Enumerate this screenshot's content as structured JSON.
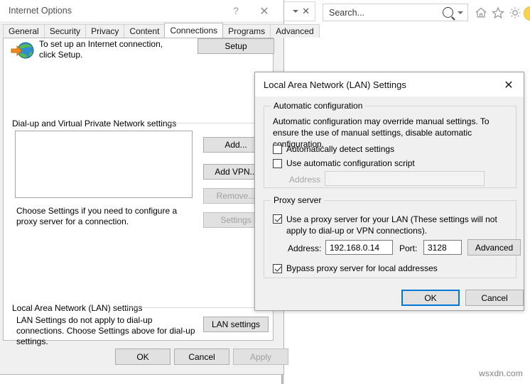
{
  "browser": {
    "tab_dropdown_icon": "chevron-down-icon",
    "tab_close_icon": "close-icon",
    "search": {
      "value": "Search...",
      "placeholder": "Search..."
    },
    "icons": [
      "home-icon",
      "favorites-star-icon",
      "gear-icon",
      "smiley-icon"
    ]
  },
  "watermark": "wsxdn.com",
  "internet_options": {
    "title": "Internet Options",
    "help_glyph": "?",
    "close_glyph": "✕",
    "tabs": [
      {
        "label": "General",
        "active": false
      },
      {
        "label": "Security",
        "active": false
      },
      {
        "label": "Privacy",
        "active": false
      },
      {
        "label": "Content",
        "active": false
      },
      {
        "label": "Connections",
        "active": true
      },
      {
        "label": "Programs",
        "active": false
      },
      {
        "label": "Advanced",
        "active": false
      }
    ],
    "setup": {
      "text": "To set up an Internet connection, click Setup.",
      "button": "Setup",
      "icon": "globe-with-arrow-icon"
    },
    "dialup": {
      "group_label": "Dial-up and Virtual Private Network settings",
      "list_items": [],
      "hint": "Choose Settings if you need to configure a proxy server for a connection.",
      "buttons": [
        {
          "label": "Add...",
          "enabled": true
        },
        {
          "label": "Add VPN...",
          "enabled": true
        },
        {
          "label": "Remove...",
          "enabled": false
        },
        {
          "label": "Settings",
          "enabled": false
        }
      ]
    },
    "lan": {
      "group_label": "Local Area Network (LAN) settings",
      "hint": "LAN Settings do not apply to dial-up connections. Choose Settings above for dial-up settings.",
      "button": "LAN settings"
    },
    "footer": {
      "ok": "OK",
      "cancel": "Cancel",
      "apply": "Apply",
      "apply_enabled": false
    }
  },
  "lan_dialog": {
    "title": "Local Area Network (LAN) Settings",
    "close_glyph": "✕",
    "automatic_configuration": {
      "legend": "Automatic configuration",
      "description": "Automatic configuration may override manual settings.  To ensure the use of manual settings, disable automatic configuration.",
      "auto_detect": {
        "label": "Automatically detect settings",
        "checked": false
      },
      "auto_script": {
        "label": "Use automatic configuration script",
        "checked": false
      },
      "address_label": "Address",
      "address_value": "",
      "address_enabled": false
    },
    "proxy_server": {
      "legend": "Proxy server",
      "use_proxy": {
        "label": "Use a proxy server for your LAN (These settings will not apply to dial-up or VPN connections).",
        "checked": true
      },
      "address_label": "Address:",
      "address_value": "192.168.0.14",
      "port_label": "Port:",
      "port_value": "3128",
      "advanced_button": "Advanced",
      "bypass": {
        "label": "Bypass proxy server for local addresses",
        "checked": true
      }
    },
    "footer": {
      "ok": "OK",
      "cancel": "Cancel",
      "focused": "ok"
    }
  },
  "colors": {
    "focus_blue": "#0078d7",
    "dialog_face": "#f0f0f0",
    "button_face": "#e1e1e1",
    "disabled_text": "#a0a0a0"
  }
}
